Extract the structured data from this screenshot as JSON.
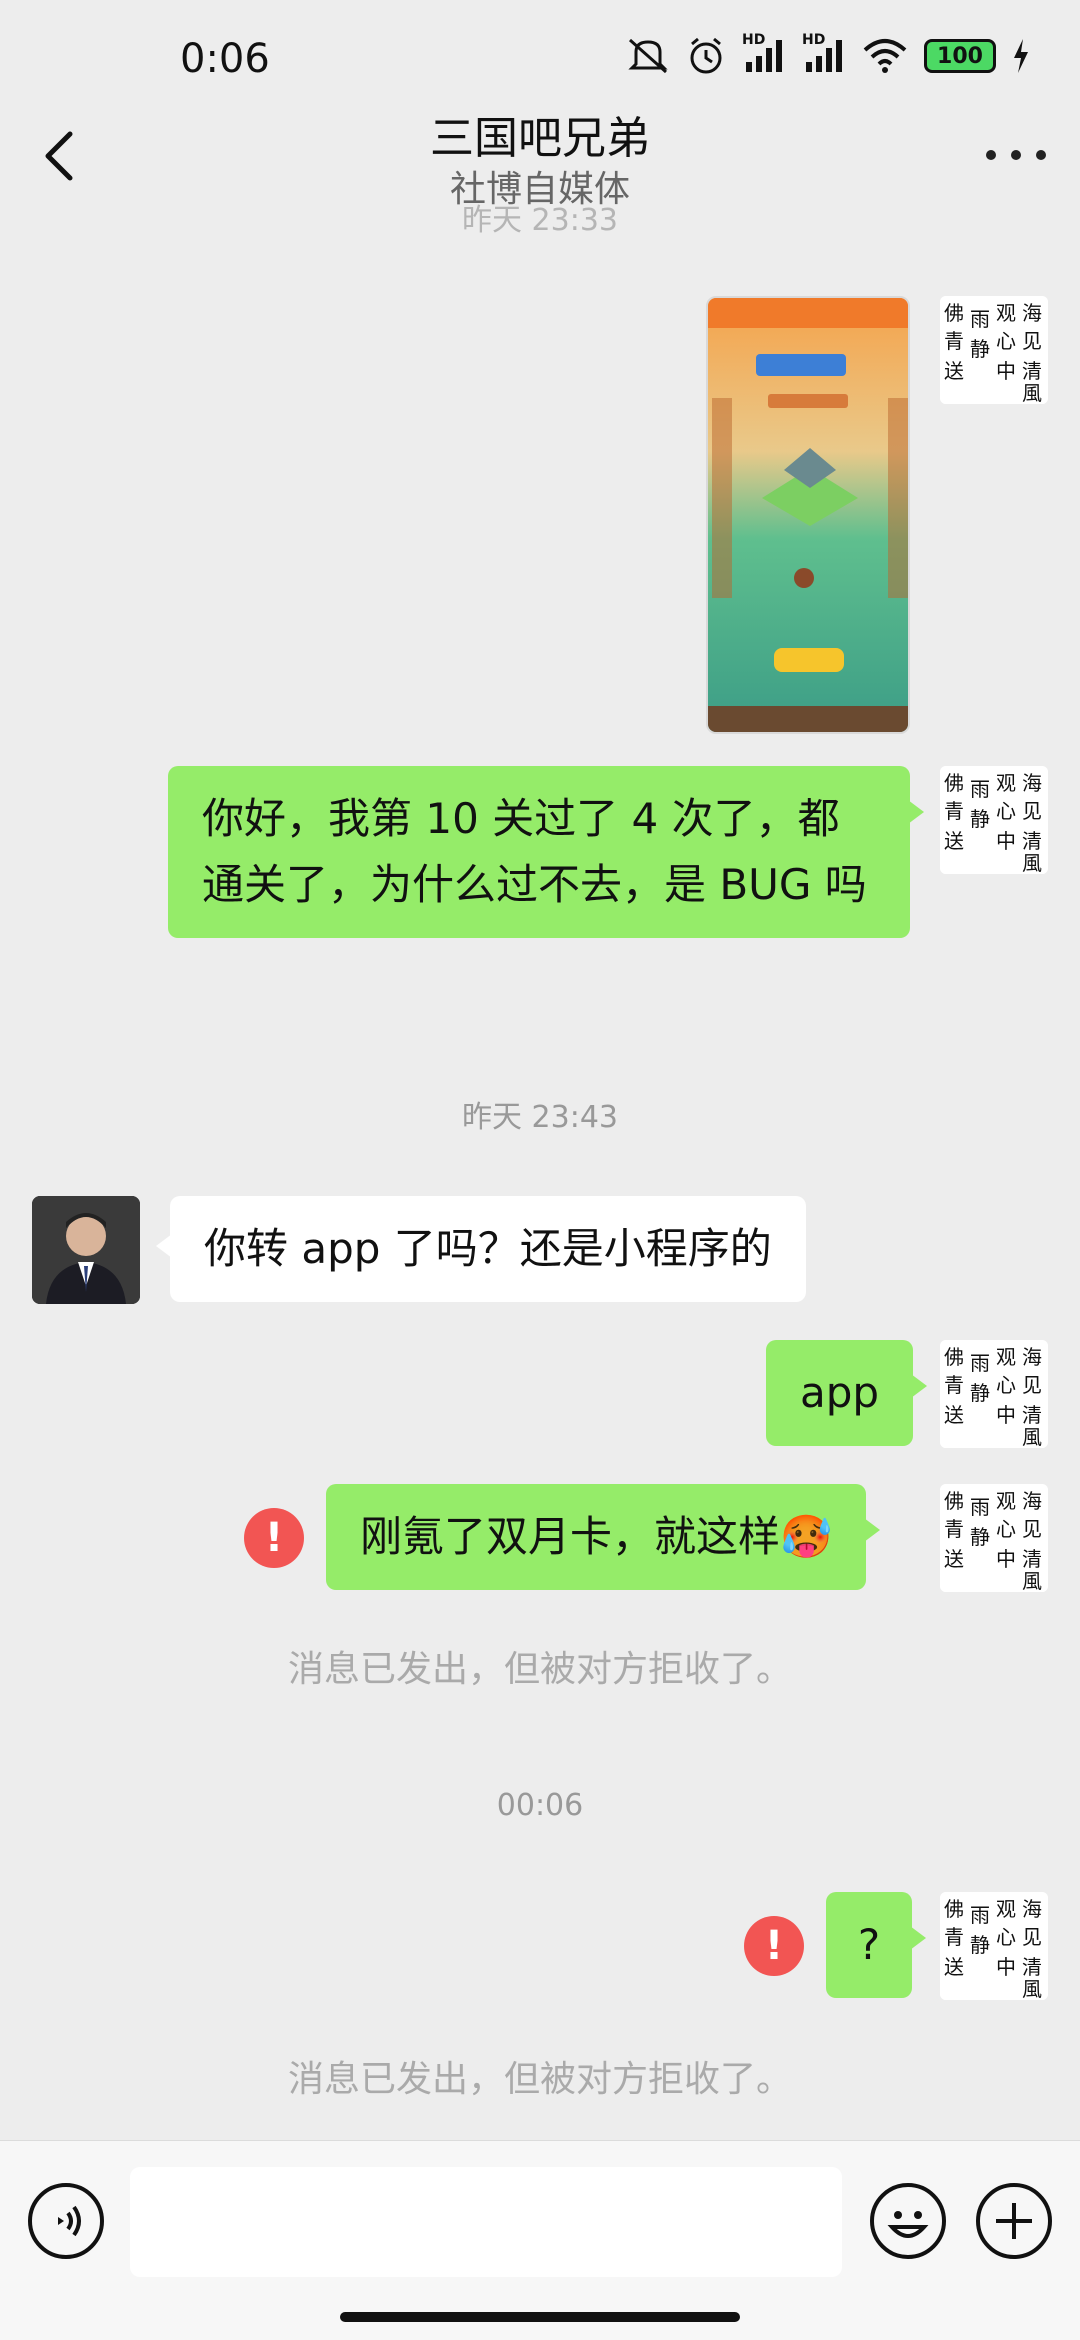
{
  "status_bar": {
    "time": "0:06",
    "battery": "100",
    "signal_labels": [
      "HD",
      "HD"
    ],
    "icons": [
      "mute-icon",
      "alarm-icon",
      "signal-icon",
      "signal-icon",
      "wifi-icon",
      "battery-icon",
      "charging-icon"
    ]
  },
  "nav": {
    "title": "三国吧兄弟",
    "subtitle": "社博自媒体",
    "back_icon": "chevron-left-icon",
    "more_icon": "more-dots-icon",
    "partial_timestamp": "昨天 23:33"
  },
  "messages": {
    "m1_text": "你好，我第 10 关过了 4 次了，都通关了，为什么过不去，是 BUG 吗",
    "ts1": "昨天 23:43",
    "m2_text": "你转 app 了吗？还是小程序的",
    "m3_text": "app",
    "m4_text": "刚氪了双月卡，就这样",
    "m4_emoji": "🥵",
    "rejected_note_1": "消息已发出，但被对方拒收了。",
    "ts2": "00:06",
    "m5_text": "?",
    "rejected_note_2": "消息已发出，但被对方拒收了。",
    "error_mark": "!"
  },
  "avatar_me_chars": [
    "佛",
    "观",
    "海",
    "雨",
    "心",
    "见",
    "送",
    "静",
    "清",
    "青",
    "中",
    "風"
  ],
  "input_bar": {
    "voice_icon": "voice-icon",
    "emoji_icon": "emoji-icon",
    "plus_icon": "plus-icon"
  },
  "colors": {
    "my_bubble": "#95ec69",
    "other_bubble": "#ffffff",
    "background": "#ededed",
    "error": "#f25553"
  }
}
